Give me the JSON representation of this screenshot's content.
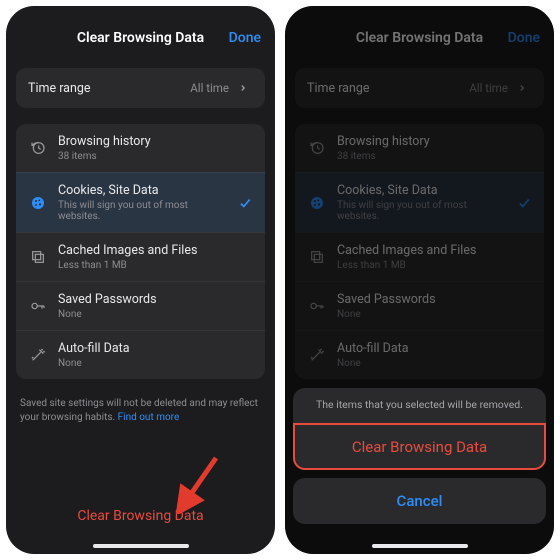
{
  "colors": {
    "accent": "#2e8ef7",
    "destructive": "#e84c3d",
    "bg": "#1c1c1e",
    "card": "#2a2a2c"
  },
  "header": {
    "title": "Clear Browsing Data",
    "done": "Done"
  },
  "time_range": {
    "label": "Time range",
    "value": "All time"
  },
  "items": [
    {
      "icon": "history-icon",
      "title": "Browsing history",
      "sub": "38 items"
    },
    {
      "icon": "cookie-icon",
      "title": "Cookies, Site Data",
      "sub": "This will sign you out of most websites."
    },
    {
      "icon": "cache-icon",
      "title": "Cached Images and Files",
      "sub": "Less than 1 MB"
    },
    {
      "icon": "key-icon",
      "title": "Saved Passwords",
      "sub": "None"
    },
    {
      "icon": "autofill-icon",
      "title": "Auto-fill Data",
      "sub": "None"
    }
  ],
  "footnote": {
    "text": "Saved site settings will not be deleted and may reflect your browsing habits. ",
    "link": "Find out more"
  },
  "bottom_action": "Clear Browsing Data",
  "sheet": {
    "message": "The items that you selected will be removed.",
    "clear": "Clear Browsing Data",
    "cancel": "Cancel"
  }
}
